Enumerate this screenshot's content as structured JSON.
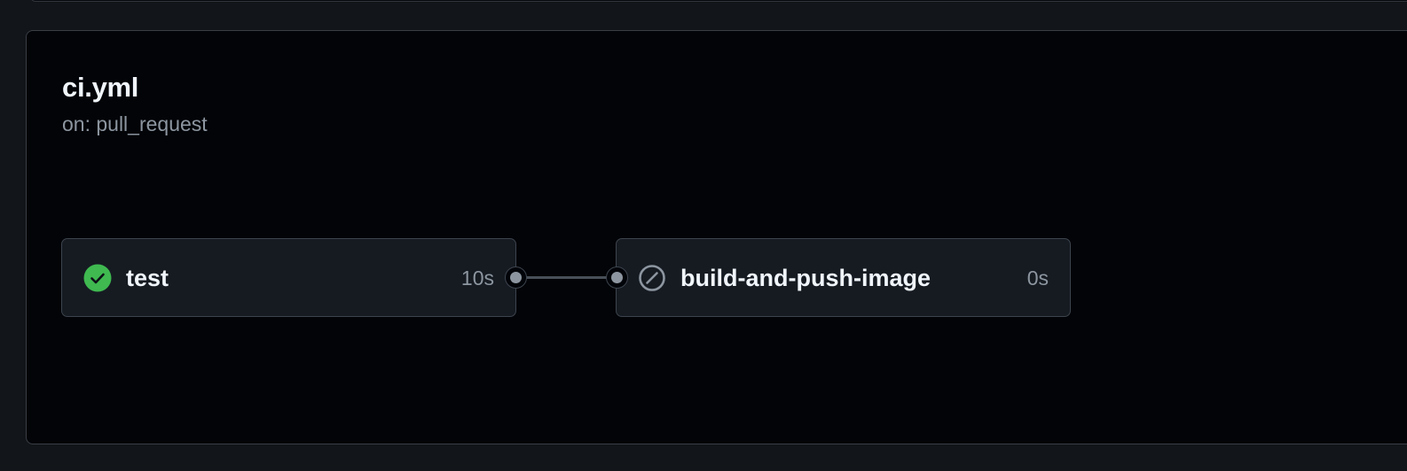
{
  "workflow": {
    "title": "ci.yml",
    "trigger": "on: pull_request"
  },
  "jobs": [
    {
      "name": "test",
      "duration": "10s",
      "status": "success",
      "status_icon": "check-circle-icon",
      "status_color": "#3fb950"
    },
    {
      "name": "build-and-push-image",
      "duration": "0s",
      "status": "skipped",
      "status_icon": "skipped-icon",
      "status_color": "#8d96a0"
    }
  ],
  "colors": {
    "background": "#121519",
    "panel": "#020408",
    "card": "#161b22",
    "border": "#3d444d",
    "text": "#f0f6fc",
    "muted": "#8d96a0"
  }
}
